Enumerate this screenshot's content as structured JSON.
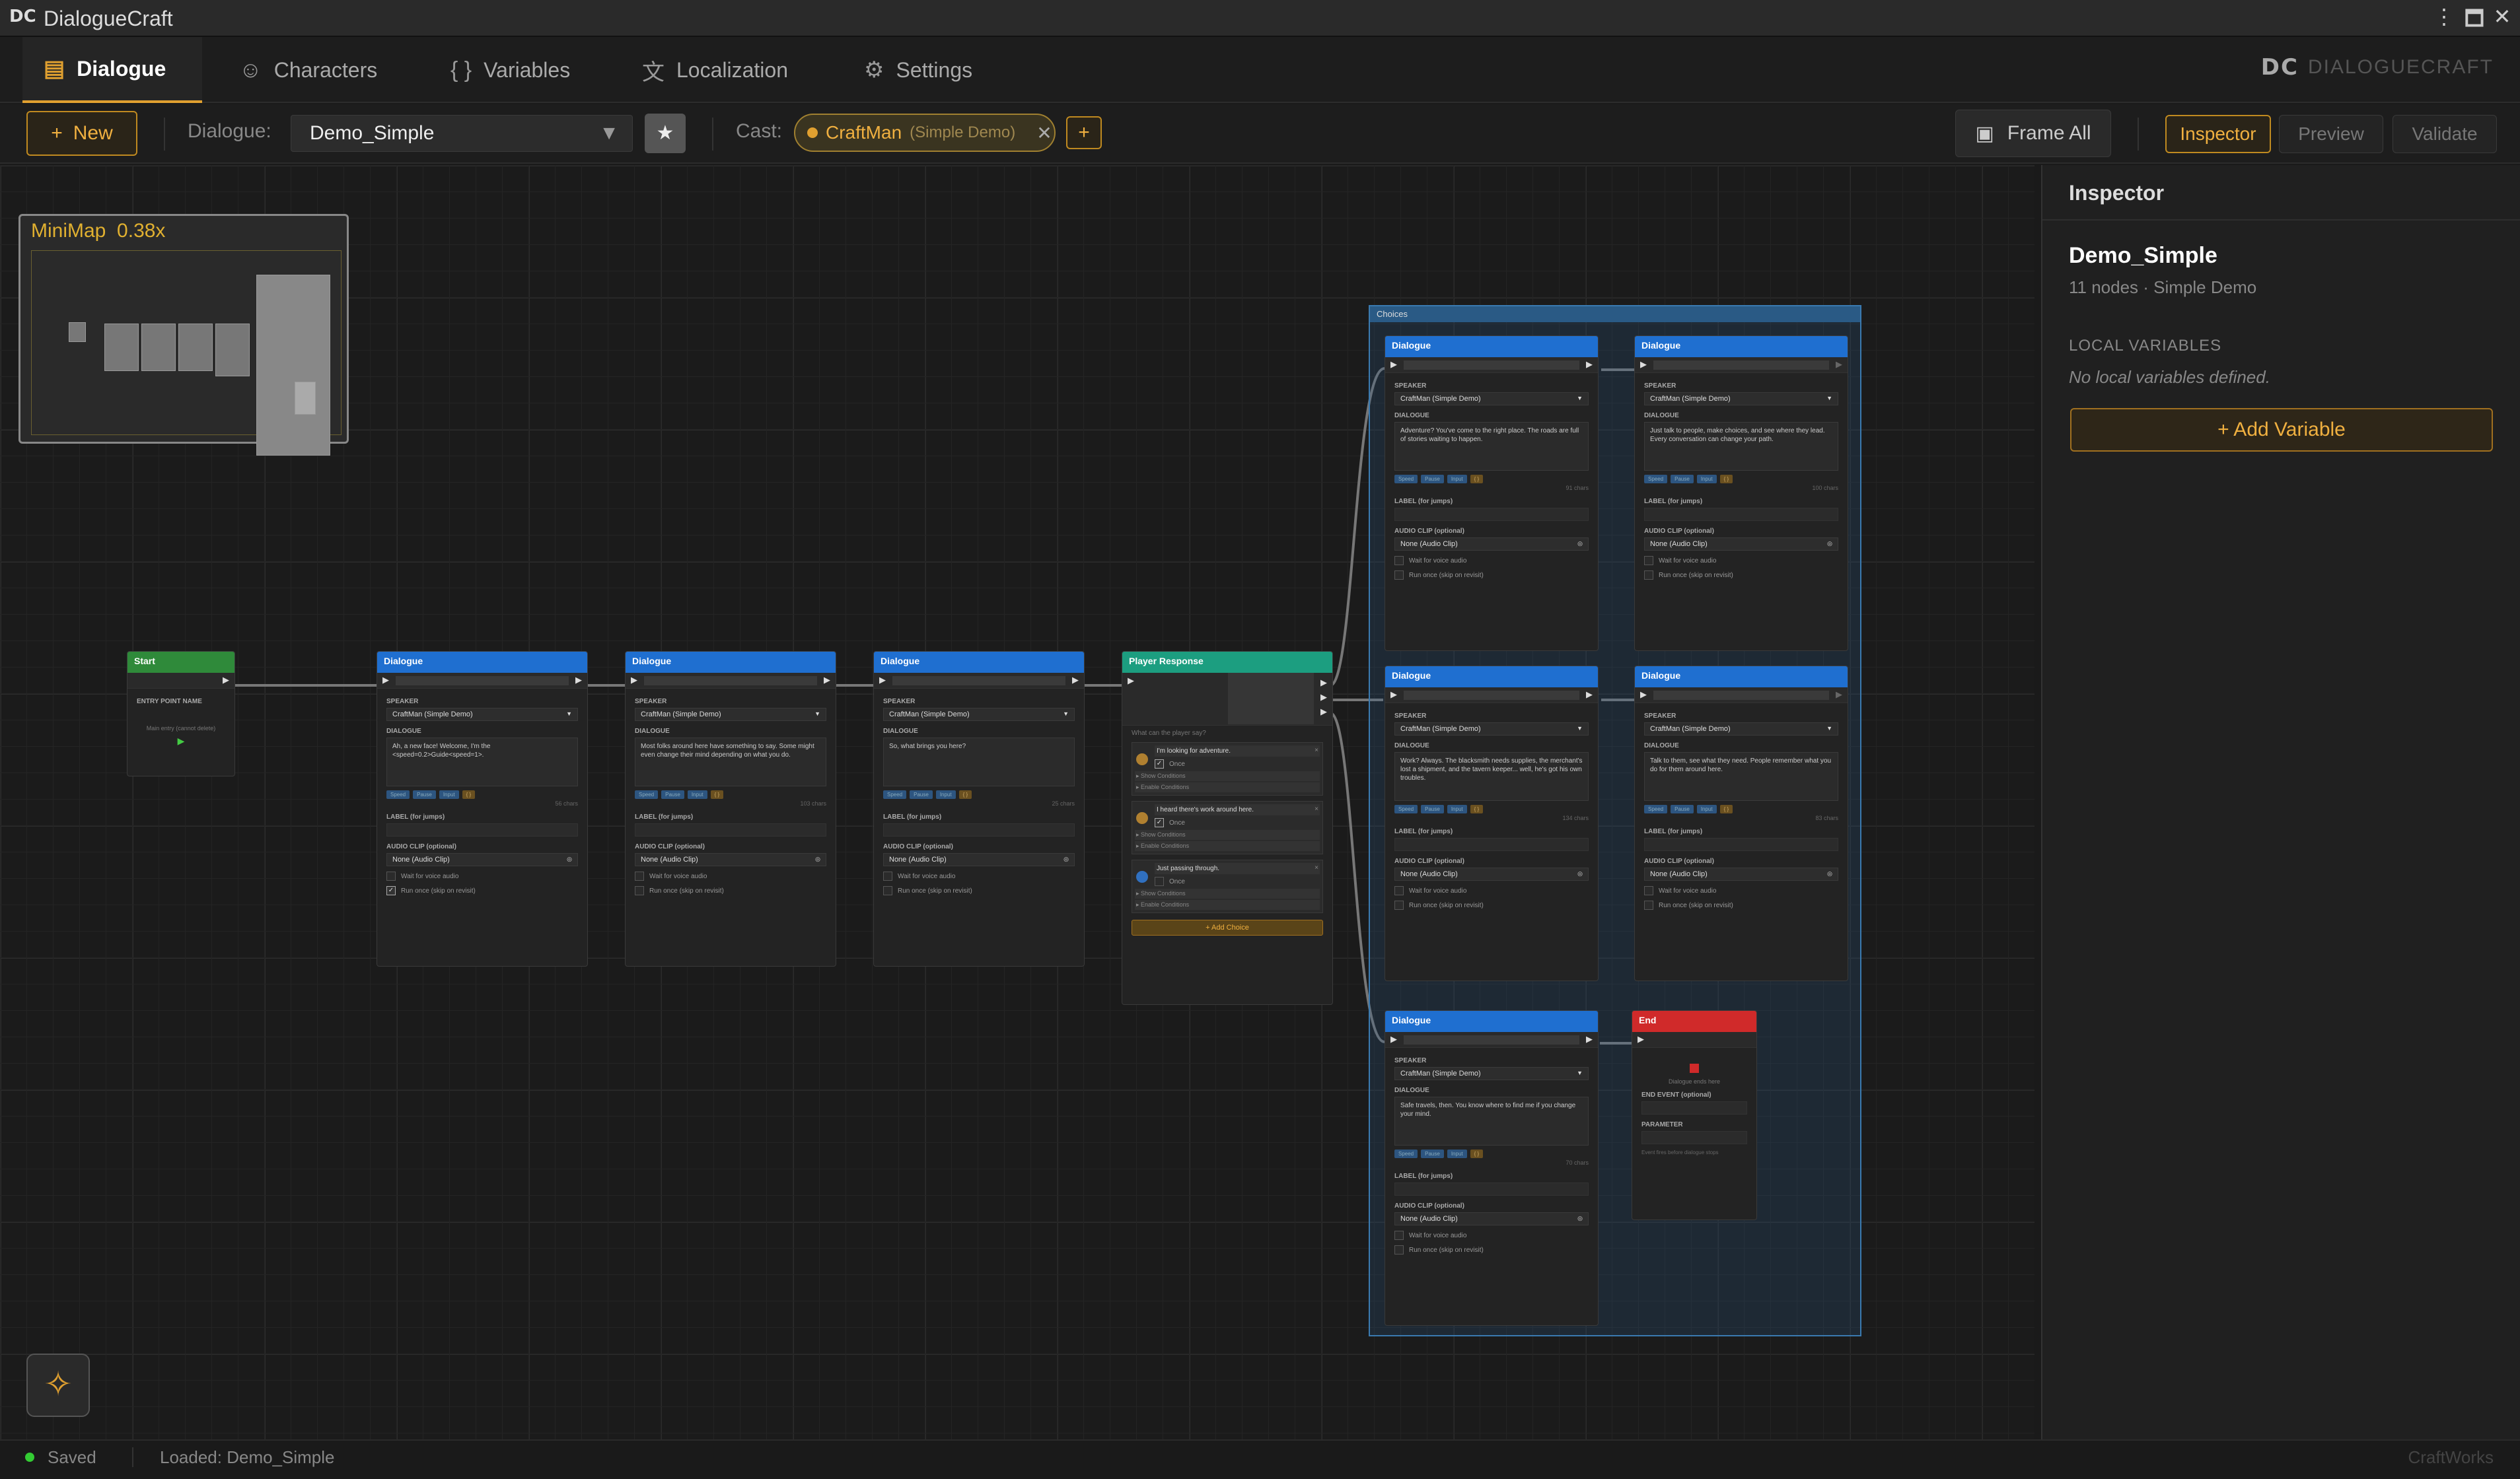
{
  "app": {
    "title": "DialogueCraft",
    "brand": "DIALOGUECRAFT",
    "logo": "DC"
  },
  "tabs": [
    {
      "label": "Dialogue",
      "icon": "dialogue-icon"
    },
    {
      "label": "Characters",
      "icon": "characters-icon"
    },
    {
      "label": "Variables",
      "icon": "braces-icon"
    },
    {
      "label": "Localization",
      "icon": "translate-icon"
    },
    {
      "label": "Settings",
      "icon": "gear-icon"
    }
  ],
  "toolbar": {
    "new_label": "New",
    "dialogue_label": "Dialogue:",
    "dialogue_value": "Demo_Simple",
    "cast_label": "Cast:",
    "cast_chip": {
      "name": "CraftMan",
      "sub": "(Simple Demo)"
    },
    "frame_all": "Frame All",
    "inspector": "Inspector",
    "preview": "Preview",
    "validate": "Validate"
  },
  "minimap": {
    "title": "MiniMap",
    "zoom": "0.38x"
  },
  "nodes": {
    "start": {
      "title": "Start",
      "field_label": "ENTRY POINT NAME",
      "hint": "Main entry (cannot delete)"
    },
    "dialogue_common": {
      "title": "Dialogue",
      "speaker_label": "SPEAKER",
      "speaker": "CraftMan (Simple Demo)",
      "dialogue_label": "DIALOGUE",
      "label_label": "LABEL (for jumps)",
      "audio_label": "AUDIO CLIP (optional)",
      "audio_value": "None (Audio Clip)",
      "wait": "Wait for voice audio",
      "once": "Run once (skip on revisit)",
      "tags": [
        "Speed",
        "Pause",
        "Input",
        "{ }"
      ]
    },
    "dialogues": [
      {
        "text": "Ah, a new face! Welcome, I'm the <speed=0.2>Guide<speed=1>.",
        "chars": "56 chars"
      },
      {
        "text": "Most folks around here have something to say. Some might even change their mind depending on what you do.",
        "chars": "103 chars"
      },
      {
        "text": "So, what brings you here?",
        "chars": "25 chars"
      },
      {
        "text": "Adventure? You've come to the right place. The roads are full of stories waiting to happen.",
        "chars": "91 chars"
      },
      {
        "text": "Just talk to people, make choices, and see where they lead. Every conversation can change your path.",
        "chars": "100 chars"
      },
      {
        "text": "Work? Always. The blacksmith needs supplies, the merchant's lost a shipment, and the tavern keeper... well, he's got his own troubles.",
        "chars": "134 chars"
      },
      {
        "text": "Talk to them, see what they need. People remember what you do for them around here.",
        "chars": "83 chars"
      },
      {
        "text": "Safe travels, then. You know where to find me if you change your mind.",
        "chars": "70 chars"
      }
    ],
    "player": {
      "title": "Player Response",
      "prompt": "What can the player say?",
      "choices": [
        "I'm looking for adventure.",
        "I heard there's work around here.",
        "Just passing through."
      ],
      "once": "Once",
      "show": "Show Conditions",
      "enable": "Enable Conditions",
      "add": "+ Add Choice"
    },
    "end": {
      "title": "End",
      "hint": "Dialogue ends here",
      "event_label": "END EVENT (optional)",
      "param_label": "PARAMETER",
      "note": "Event fires before dialogue stops"
    },
    "group_title": "Choices"
  },
  "inspector": {
    "title": "Inspector",
    "name": "Demo_Simple",
    "sub": "11 nodes · Simple Demo",
    "local_vars": "LOCAL VARIABLES",
    "no_vars": "No local variables defined.",
    "add_var": "+ Add Variable"
  },
  "status": {
    "saved": "Saved",
    "loaded": "Loaded: Demo_Simple",
    "brand": "CraftWorks"
  },
  "colors": {
    "accent": "#e0a030",
    "node_blue": "#1f6fd0",
    "node_green": "#2f8a3a",
    "node_teal": "#1c9e80",
    "node_red": "#d02a2a"
  }
}
